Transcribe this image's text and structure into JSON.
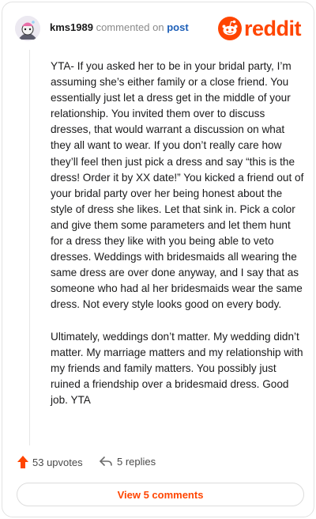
{
  "header": {
    "username": "kms1989",
    "action_text": "commented on",
    "post_link": "post",
    "brand_name": "reddit"
  },
  "comment": {
    "paragraphs": [
      "YTA- If you asked her to be in your bridal party, I’m assuming she’s either family or a close friend. You essentially just let a dress get in the middle of your relationship. You invited them over to discuss dresses, that would warrant a discussion on what they all want to wear. If you don’t really care how they’ll feel then just pick a dress and say “this is the dress! Order it by XX date!” You kicked a friend out of your bridal party over her being honest about the style of dress she likes. Let that sink in. Pick a color and give them some parameters and let them hunt for a dress they like with you being able to veto dresses. Weddings with bridesmaids all wearing the same dress are over done anyway, and I say that as someone who had al her bridesmaids wear the same dress. Not every style looks good on every body.",
      "Ultimately, weddings don’t matter. My wedding didn’t matter. My marriage matters and my relationship with my friends and family matters. You possibly just ruined a friendship over a bridesmaid dress. Good job. YTA"
    ]
  },
  "footer": {
    "upvotes_label": "53 upvotes",
    "replies_label": "5 replies",
    "view_button_label": "View 5 comments"
  },
  "colors": {
    "brand": "#ff4500",
    "link": "#1d5fb8",
    "muted": "#8a8a8a"
  },
  "icons": {
    "avatar": "snoo-avatar-icon",
    "brand": "reddit-logo-icon",
    "upvote": "upvote-arrow-icon",
    "reply": "reply-arrow-icon"
  }
}
